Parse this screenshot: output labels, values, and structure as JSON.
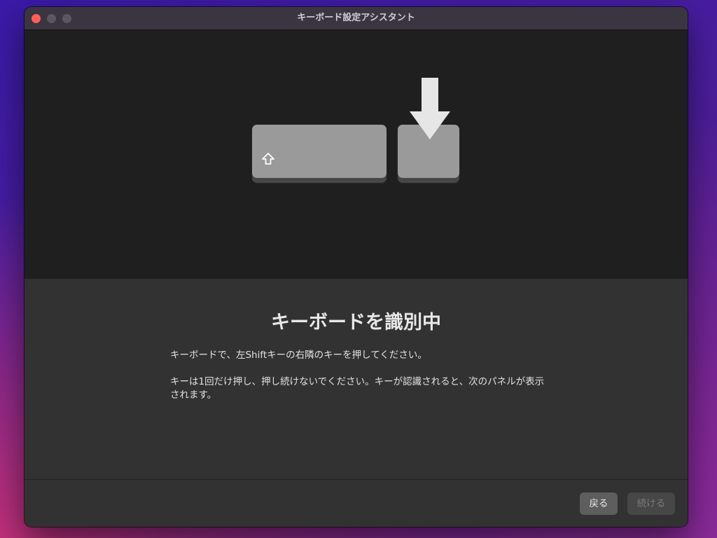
{
  "window": {
    "title": "キーボード設定アシスタント"
  },
  "illustration": {
    "shift_icon": "shift-arrow-icon",
    "arrow_icon": "down-arrow-icon"
  },
  "content": {
    "heading": "キーボードを識別中",
    "instruction": "キーボードで、左Shiftキーの右隣のキーを押してください。",
    "note": "キーは1回だけ押し、押し続けないでください。キーが認識されると、次のパネルが表示されます。"
  },
  "footer": {
    "back_label": "戻る",
    "continue_label": "続ける"
  },
  "colors": {
    "close": "#ff5f57",
    "key": "#9a9a9a",
    "arrow": "#e6e6e6"
  }
}
